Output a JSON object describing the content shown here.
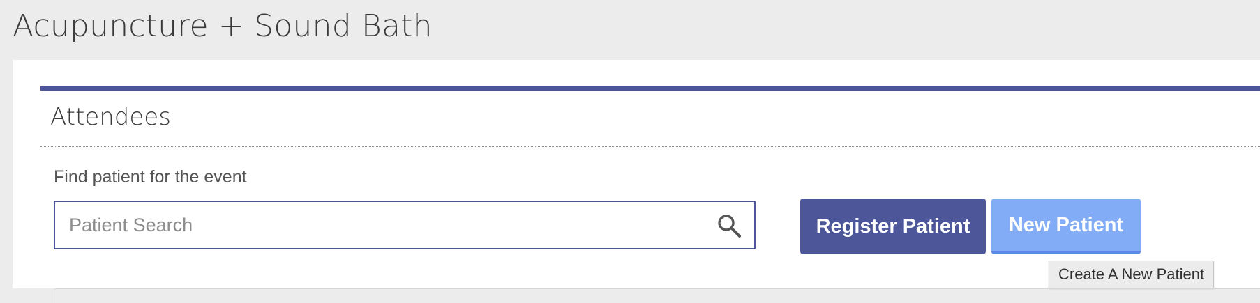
{
  "page": {
    "title": "Acupuncture + Sound Bath"
  },
  "panel": {
    "title": "Attendees",
    "accent_color": "#4c5699"
  },
  "search": {
    "label": "Find patient for the event",
    "placeholder": "Patient Search",
    "value": "",
    "icon": "search-icon"
  },
  "buttons": {
    "register_label": "Register Patient",
    "register_color": "#4c5699",
    "new_label": "New Patient",
    "new_color": "#82acf5"
  },
  "tooltip": {
    "text": "Create A New Patient"
  }
}
